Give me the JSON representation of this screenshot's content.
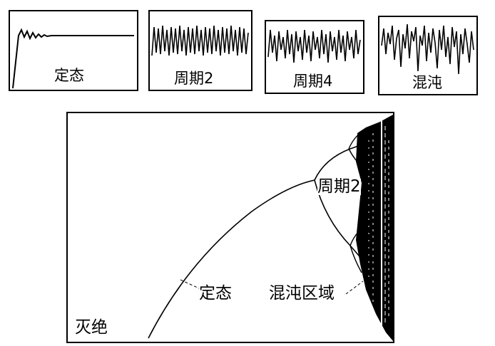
{
  "panels": [
    {
      "label": "定态"
    },
    {
      "label": "周期2"
    },
    {
      "label": "周期4"
    },
    {
      "label": "混沌"
    }
  ],
  "main": {
    "labels": {
      "period2": "周期2",
      "steady": "定态",
      "chaos": "混沌区域",
      "extinct": "灭绝"
    }
  },
  "colors": {
    "ink": "#000000",
    "paper": "#ffffff"
  }
}
